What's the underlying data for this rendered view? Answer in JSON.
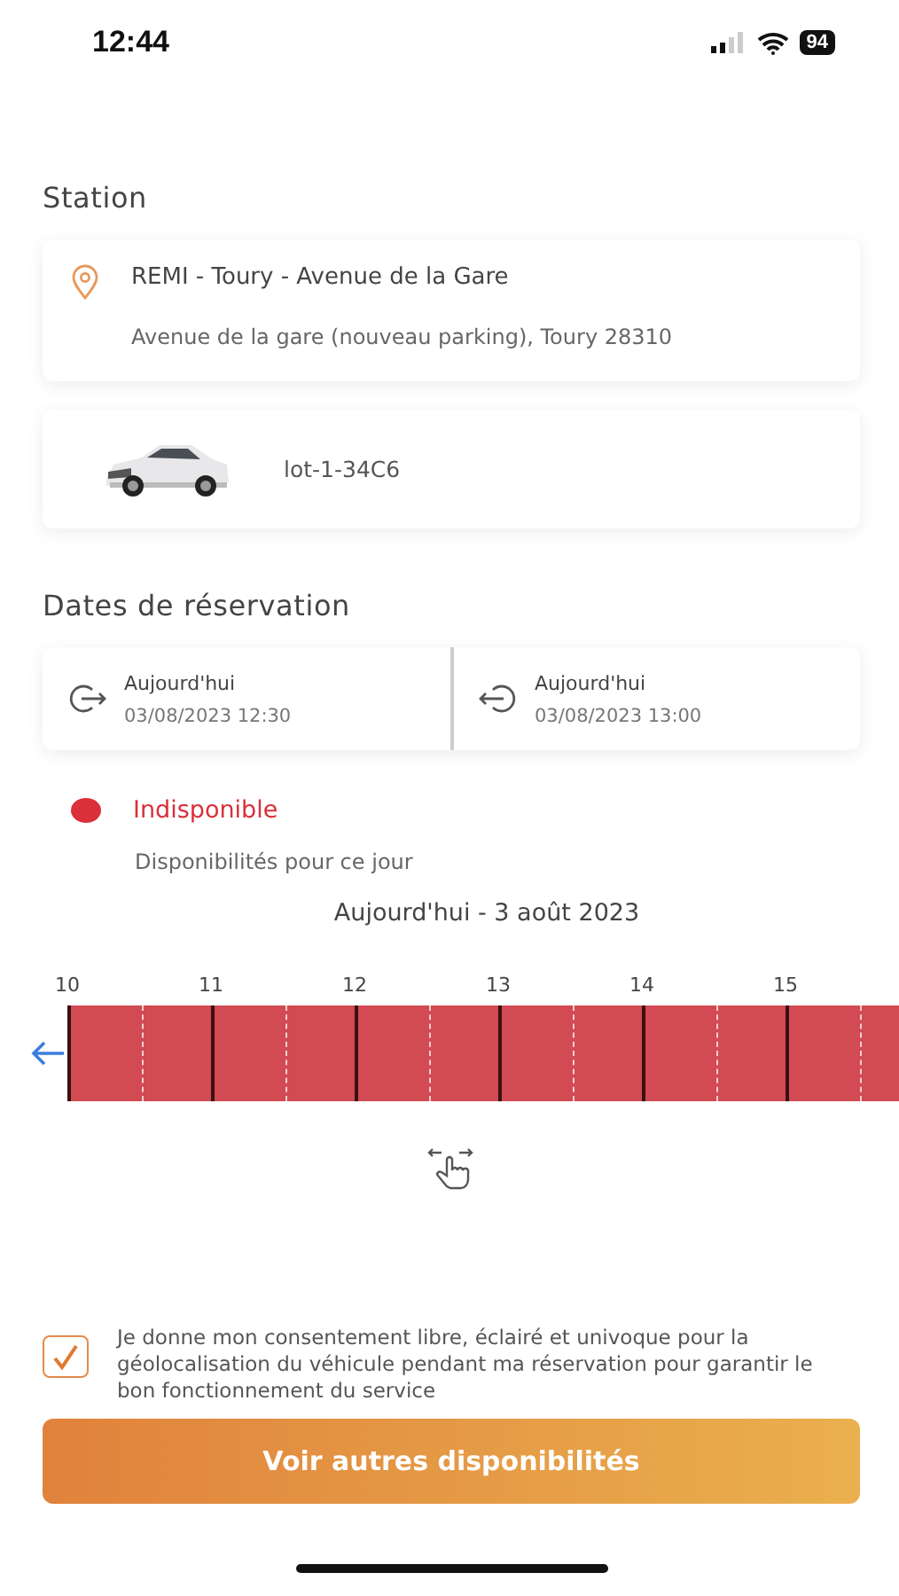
{
  "status_bar": {
    "time": "12:44",
    "battery": "94"
  },
  "station": {
    "heading": "Station",
    "name": "REMI - Toury - Avenue de la Gare",
    "address": "Avenue de la gare (nouveau parking), Toury 28310"
  },
  "vehicle": {
    "plate": "lot-1-34C6"
  },
  "dates": {
    "heading": "Dates de réservation",
    "items": [
      {
        "kind": "start",
        "label": "Aujourd'hui",
        "datetime": "03/08/2023 12:30"
      },
      {
        "kind": "end",
        "label": "Aujourd'hui",
        "datetime": "03/08/2023 13:00"
      }
    ]
  },
  "availability": {
    "status": "Indisponible",
    "color": "#d9303a",
    "caption": "Disponibilités pour ce jour",
    "day": "Aujourd'hui - 3 août 2023"
  },
  "timeline": {
    "hours": [
      "10",
      "11",
      "12",
      "13",
      "14",
      "15"
    ],
    "slots": [
      {
        "available": false
      },
      {
        "available": false
      },
      {
        "available": false
      },
      {
        "available": false
      },
      {
        "available": false
      },
      {
        "available": false
      },
      {
        "available": false
      },
      {
        "available": false
      },
      {
        "available": false
      },
      {
        "available": false
      },
      {
        "available": false
      },
      {
        "available": false
      }
    ]
  },
  "consent": {
    "checked": true,
    "text": "Je donne mon consentement libre, éclairé et univoque pour la géolocalisation du véhicule pendant ma réservation pour garantir le bon fonctionnement du service"
  },
  "button": "Voir autres disponibilités"
}
